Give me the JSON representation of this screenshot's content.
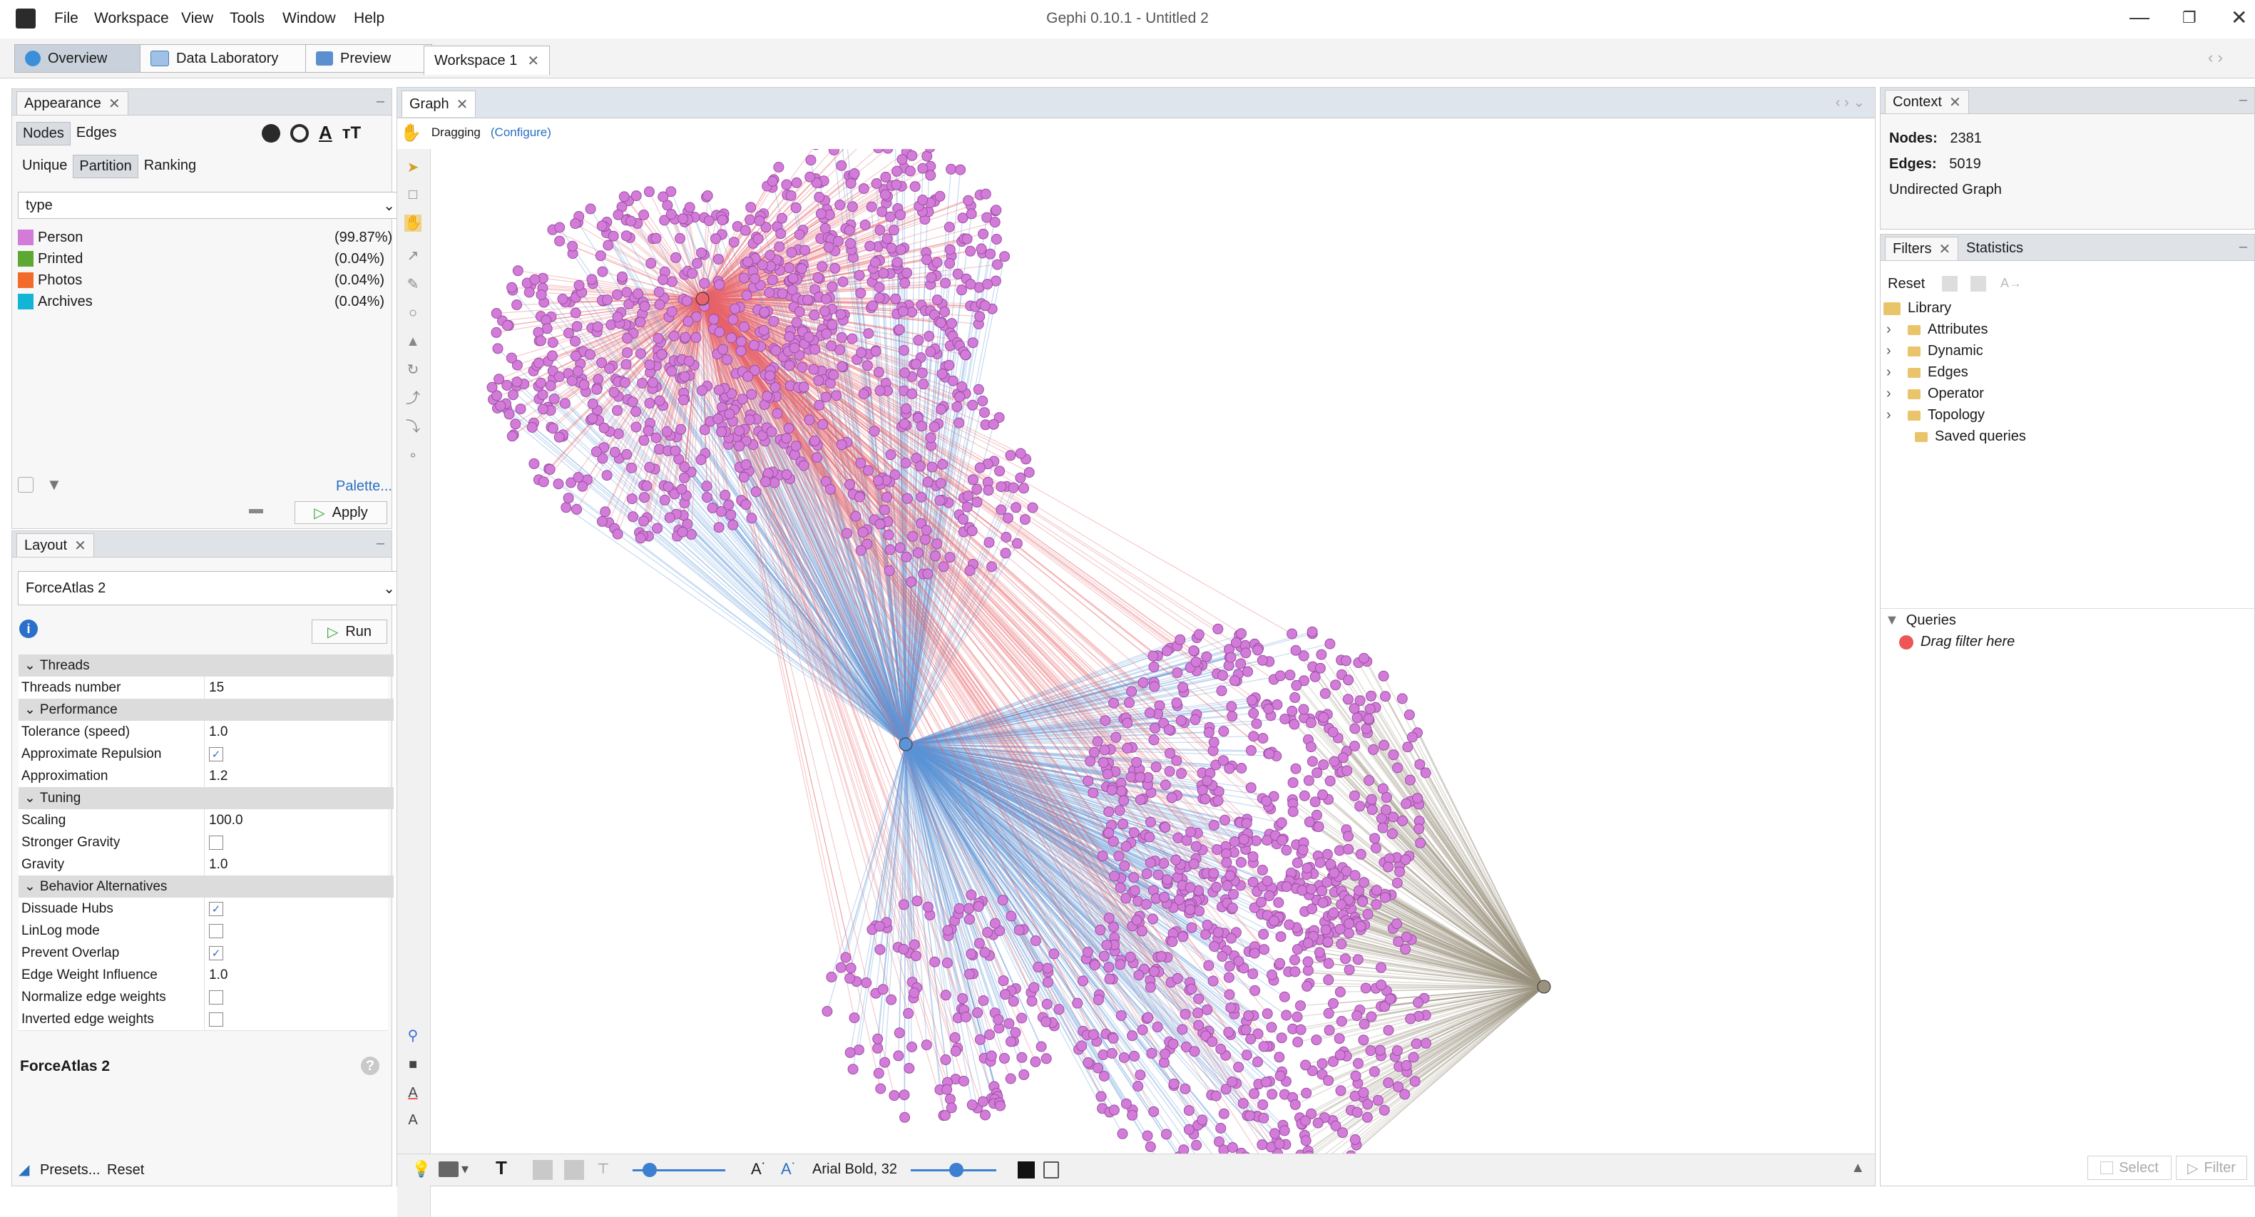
{
  "menubar": {
    "items": [
      "File",
      "Workspace",
      "View",
      "Tools",
      "Window",
      "Help"
    ],
    "title": "Gephi 0.10.1 - Untitled 2"
  },
  "toolbar": {
    "overview_label": "Overview",
    "data_lab_label": "Data Laboratory",
    "preview_label": "Preview",
    "workspace_tab": "Workspace 1"
  },
  "appearance": {
    "tab_label": "Appearance",
    "element_tabs": [
      "Nodes",
      "Edges"
    ],
    "mode_tabs": [
      "Unique",
      "Partition",
      "Ranking"
    ],
    "attribute": "type",
    "legend": [
      {
        "label": "Person",
        "pct": "(99.87%)",
        "color": "#d37bd8"
      },
      {
        "label": "Printed",
        "pct": "(0.04%)",
        "color": "#5da832"
      },
      {
        "label": "Photos",
        "pct": "(0.04%)",
        "color": "#f26b2b"
      },
      {
        "label": "Archives",
        "pct": "(0.04%)",
        "color": "#14b4d6"
      }
    ],
    "palette_link": "Palette...",
    "apply_label": "Apply"
  },
  "layout": {
    "tab_label": "Layout",
    "algorithm": "ForceAtlas 2",
    "run_label": "Run",
    "sections": {
      "threads": "Threads",
      "performance": "Performance",
      "tuning": "Tuning",
      "behavior": "Behavior Alternatives"
    },
    "props": {
      "threads_number": {
        "label": "Threads number",
        "value": "15"
      },
      "tolerance": {
        "label": "Tolerance (speed)",
        "value": "1.0"
      },
      "approx_repulsion": {
        "label": "Approximate Repulsion",
        "checked": true
      },
      "approximation": {
        "label": "Approximation",
        "value": "1.2"
      },
      "scaling": {
        "label": "Scaling",
        "value": "100.0"
      },
      "stronger_gravity": {
        "label": "Stronger Gravity",
        "checked": false
      },
      "gravity": {
        "label": "Gravity",
        "value": "1.0"
      },
      "dissuade_hubs": {
        "label": "Dissuade Hubs",
        "checked": true
      },
      "linlog": {
        "label": "LinLog mode",
        "checked": false
      },
      "prevent_overlap": {
        "label": "Prevent Overlap",
        "checked": true
      },
      "edge_weight_influence": {
        "label": "Edge Weight Influence",
        "value": "1.0"
      },
      "normalize_edge_weights": {
        "label": "Normalize edge weights",
        "checked": false
      },
      "inverted_edge_weights": {
        "label": "Inverted edge weights",
        "checked": false
      }
    },
    "description_title": "ForceAtlas 2",
    "presets_label": "Presets...",
    "reset_label": "Reset"
  },
  "graph": {
    "tab_label": "Graph",
    "mode_label": "Dragging",
    "configure_label": "(Configure)",
    "font_label": "Arial Bold, 32"
  },
  "context": {
    "tab_label": "Context",
    "nodes_label": "Nodes:",
    "nodes_value": "2381",
    "edges_label": "Edges:",
    "edges_value": "5019",
    "graph_type": "Undirected Graph"
  },
  "filters": {
    "tab_label": "Filters",
    "stats_tab_label": "Statistics",
    "reset_label": "Reset",
    "library_label": "Library",
    "library_items": [
      "Attributes",
      "Dynamic",
      "Edges",
      "Operator",
      "Topology"
    ],
    "saved_queries": "Saved queries",
    "queries_label": "Queries",
    "drag_hint": "Drag filter here",
    "select_label": "Select",
    "filter_label": "Filter"
  },
  "colors": {
    "person": "#d37bd8",
    "hub_red": "#e8636a",
    "hub_blue": "#5b95d8",
    "hub_gray": "#9a927e"
  }
}
